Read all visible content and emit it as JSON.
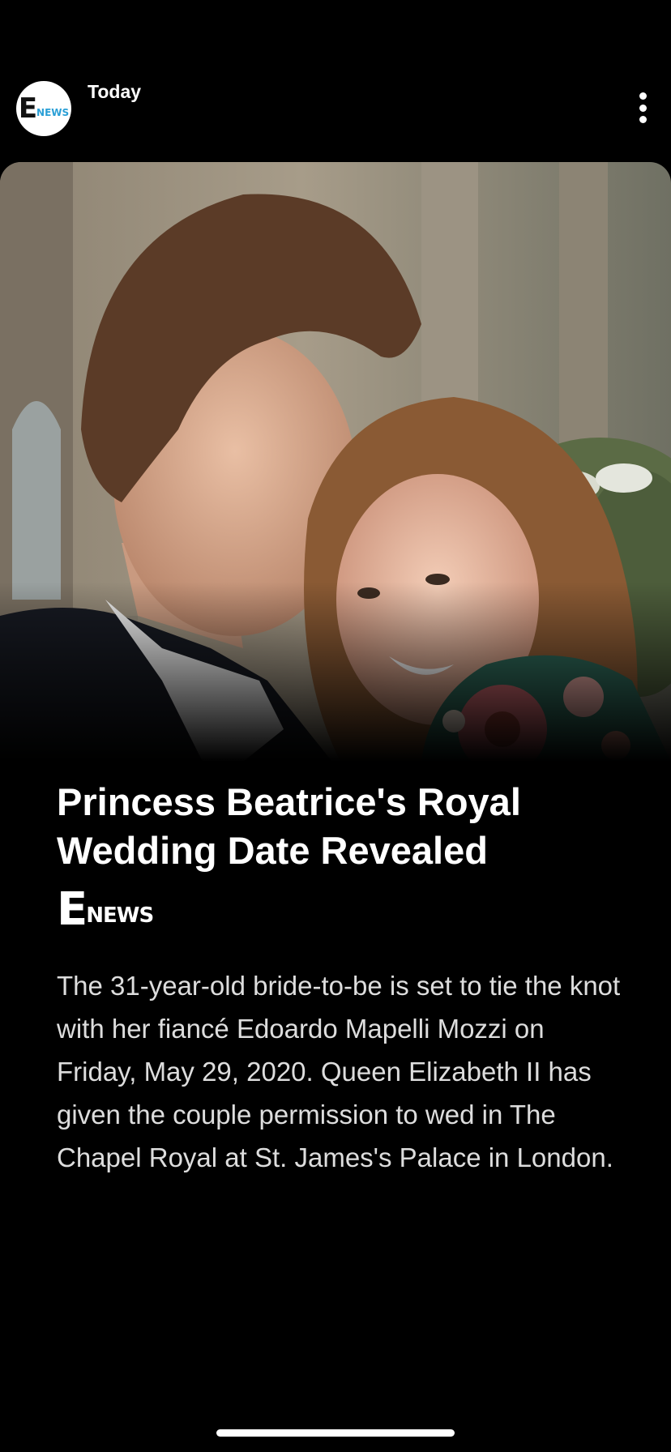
{
  "header": {
    "title": "Today",
    "avatar_logo_text": "E! NEWS"
  },
  "story": {
    "headline": "Princess Beatrice's Royal Wedding Date Revealed",
    "source_logo": "E! NEWS",
    "body": "The 31-year-old bride-to-be is set to tie the knot with her fiancé Edoardo Mapelli Mozzi on Friday, May 29, 2020. Queen Elizabeth II has given the couple permission to wed in The Chapel Royal at St. James's Palace in London."
  },
  "icons": {
    "more": "more-vertical-icon"
  },
  "colors": {
    "background": "#000000",
    "text": "#ffffff",
    "body_text": "#dddddd",
    "enews_accent": "#2a9fd6"
  }
}
